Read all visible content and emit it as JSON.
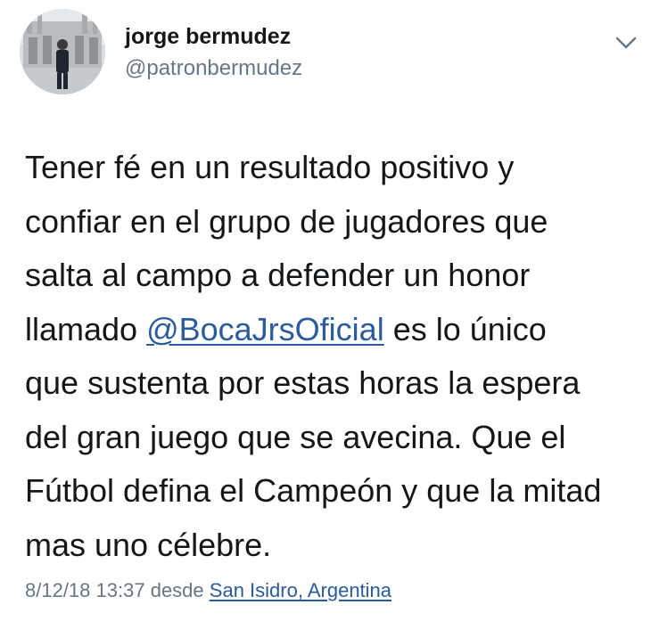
{
  "author": {
    "display_name": "jorge bermudez",
    "handle": "@patronbermudez",
    "avatar_icon": "profile-photo"
  },
  "menu": {
    "icon": "chevron-down-icon"
  },
  "tweet": {
    "line1": "Tener fé en un resultado positivo y",
    "line2": "confiar en el grupo de jugadores que",
    "line3": "salta al campo a defender un honor",
    "line4_pre": "llamado ",
    "mention": "@BocaJrsOficial",
    "line4_post": " es lo único",
    "line5": "que sustenta por estas horas la espera",
    "line6": "del gran juego que se avecina. Que el",
    "line7": "Fútbol defina el Campeón y que la mitad",
    "line8": "mas uno célebre."
  },
  "meta": {
    "timestamp": "8/12/18 13:37",
    "via": "desde",
    "location": "San Isidro, Argentina"
  },
  "colors": {
    "text": "#14171a",
    "secondary": "#657786",
    "link": "#2b5b9c"
  }
}
